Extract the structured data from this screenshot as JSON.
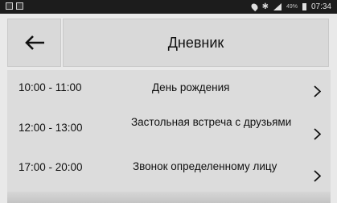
{
  "status_bar": {
    "battery_percent": "49%",
    "time": "07:34"
  },
  "header": {
    "back_icon": "arrow-left-icon",
    "title": "Дневник"
  },
  "entries": [
    {
      "time": "10:00 - 11:00",
      "label": "День рождения",
      "chevron_icon": "chevron-right-icon"
    },
    {
      "time": "12:00 - 13:00",
      "label": "Застольная встреча с друзьями",
      "chevron_icon": "chevron-right-icon"
    },
    {
      "time": "17:00 - 20:00",
      "label": "Звонок определенному лицу",
      "chevron_icon": "chevron-right-icon"
    }
  ]
}
